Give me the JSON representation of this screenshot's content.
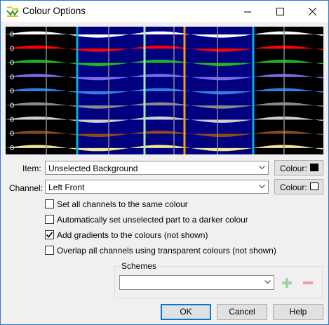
{
  "window": {
    "title": "Colour Options"
  },
  "preview": {
    "row_label": "0",
    "channel_colors": [
      "#ffffff",
      "#ff0000",
      "#1fb51f",
      "#7a6be8",
      "#2d7fe0",
      "#8a8a8a",
      "#cfcfcf",
      "#8a4a1a",
      "#f1e890"
    ],
    "colors": {
      "unselected_background": "#000000",
      "selected_background": "#000080",
      "marker_blue": "#10a8e8",
      "marker_orange": "#f0a010",
      "marker_green": "#a8e8c0",
      "grid": "#8a8a8a"
    }
  },
  "item": {
    "label": "Item:",
    "value": "Unselected Background",
    "colour_button": "Colour:",
    "swatch_color": "#000000"
  },
  "channel": {
    "label": "Channel:",
    "value": "Left Front",
    "colour_button": "Colour:",
    "swatch_color": "#ffffff"
  },
  "options": [
    {
      "label": "Set all channels to the same colour",
      "checked": false
    },
    {
      "label": "Automatically set unselected part to a darker colour",
      "checked": false
    },
    {
      "label": "Add gradients to the colours (not shown)",
      "checked": true
    },
    {
      "label": "Overlap all channels using transparent colours (not shown)",
      "checked": false
    }
  ],
  "schemes": {
    "title": "Schemes",
    "value": ""
  },
  "buttons": {
    "ok": "OK",
    "cancel": "Cancel",
    "help": "Help"
  }
}
